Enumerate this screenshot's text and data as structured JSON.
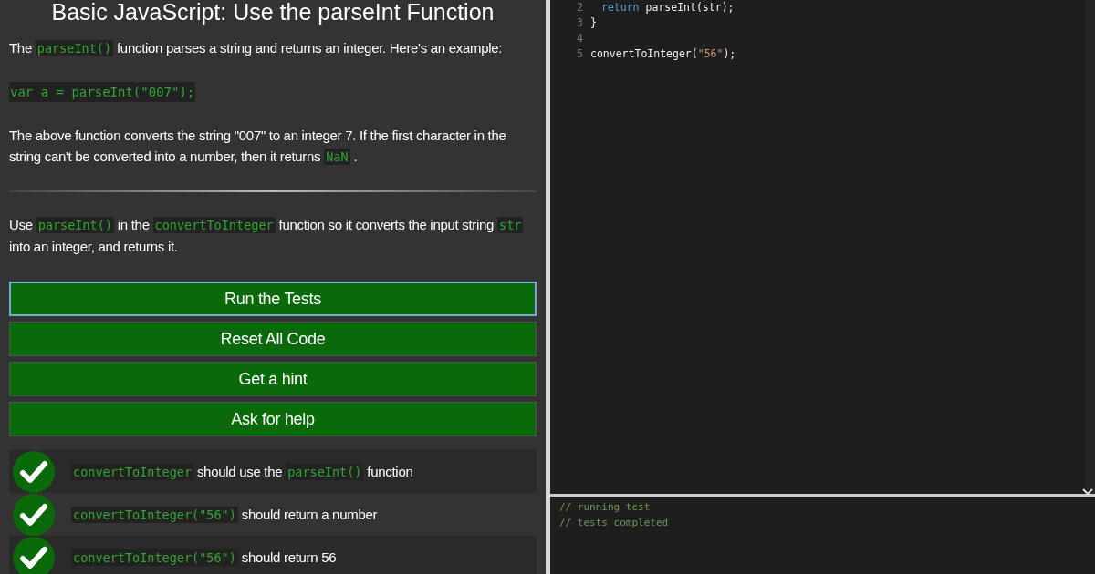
{
  "challenge": {
    "title": "Basic JavaScript: Use the parseInt Function",
    "description": [
      [
        {
          "kind": "text",
          "text": "The"
        },
        {
          "kind": "code",
          "text": "parseInt()"
        },
        {
          "kind": "text",
          "text": "function parses a string and returns an integer. Here's an example:"
        }
      ],
      [
        {
          "kind": "block",
          "text": "var a = parseInt(\"007\");"
        }
      ],
      [
        {
          "kind": "text",
          "text": "The above function converts the string \"007\" to an integer 7. If the first character in the string can't be converted into a number, then it returns"
        },
        {
          "kind": "code",
          "text": "NaN"
        },
        {
          "kind": "text",
          "text": "."
        }
      ]
    ],
    "instructions": [
      [
        {
          "kind": "text",
          "text": "Use"
        },
        {
          "kind": "code",
          "text": "parseInt()"
        },
        {
          "kind": "text",
          "text": "in the"
        },
        {
          "kind": "code",
          "text": "convertToInteger"
        },
        {
          "kind": "text",
          "text": "function so it converts the input string"
        },
        {
          "kind": "code",
          "text": "str"
        },
        {
          "kind": "text",
          "text": "into an integer, and returns it."
        }
      ]
    ],
    "buttons": [
      {
        "label": "Run the Tests",
        "focused": true
      },
      {
        "label": "Reset All Code",
        "focused": false
      },
      {
        "label": "Get a hint",
        "focused": false
      },
      {
        "label": "Ask for help",
        "focused": false
      }
    ],
    "tests": [
      {
        "passed": true,
        "parts": [
          {
            "kind": "code",
            "text": "convertToInteger"
          },
          {
            "kind": "text",
            "text": "should use the"
          },
          {
            "kind": "code",
            "text": "parseInt()"
          },
          {
            "kind": "text",
            "text": "function"
          }
        ]
      },
      {
        "passed": true,
        "parts": [
          {
            "kind": "code",
            "text": "convertToInteger(\"56\")"
          },
          {
            "kind": "text",
            "text": "should return a number"
          }
        ]
      },
      {
        "passed": true,
        "parts": [
          {
            "kind": "code",
            "text": "convertToInteger(\"56\")"
          },
          {
            "kind": "text",
            "text": "should return 56"
          }
        ]
      }
    ]
  },
  "editor": {
    "lines": [
      {
        "number": "2",
        "tokens": [
          {
            "kind": "keyword",
            "text": "return"
          },
          {
            "kind": "plain",
            "text": "parseInt(str);"
          }
        ]
      },
      {
        "number": "3",
        "tokens": [
          {
            "kind": "plain",
            "text": "}"
          }
        ]
      },
      {
        "number": "4"
      },
      {
        "number": "5",
        "tokens": [
          {
            "kind": "plain",
            "text": "convertToInteger("
          },
          {
            "kind": "string",
            "text": "\"56\""
          },
          {
            "kind": "plain",
            "text": ");"
          }
        ]
      }
    ]
  },
  "console": {
    "lines": [
      "// running test",
      "// tests completed"
    ]
  }
}
